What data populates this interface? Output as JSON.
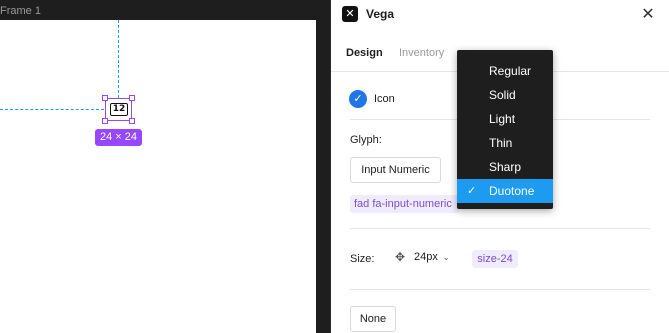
{
  "canvas": {
    "frame_label": "Frame 1",
    "icon_glyph_text": "12",
    "selection_size": "24 × 24"
  },
  "plugin": {
    "title": "Vega",
    "logo_glyph": "✕",
    "close_glyph": "✕",
    "tabs": [
      {
        "label": "Design",
        "active": true
      },
      {
        "label": "Inventory",
        "active": false
      }
    ],
    "icon_row": {
      "check_glyph": "✓",
      "label": "Icon"
    },
    "glyph": {
      "label": "Glyph:",
      "button_label": "Input Numeric",
      "class_name": "fad fa-input-numeric"
    },
    "size": {
      "label": "Size:",
      "value": "24px",
      "chip": "size-24",
      "resize_icon_glyph": "✥",
      "chevron_glyph": "⌄"
    },
    "none_button": "None"
  },
  "style_menu": {
    "selected": "Duotone",
    "check_glyph": "✓",
    "items": [
      "Regular",
      "Solid",
      "Light",
      "Thin",
      "Sharp",
      "Duotone"
    ]
  },
  "colors": {
    "accent_purple": "#9747ff",
    "selection_blue": "#1d9bf0",
    "check_blue": "#1e76e8",
    "chip_bg": "#f1ecfd",
    "chip_text": "#7b4ccf",
    "menu_bg": "#1e1e1e"
  }
}
